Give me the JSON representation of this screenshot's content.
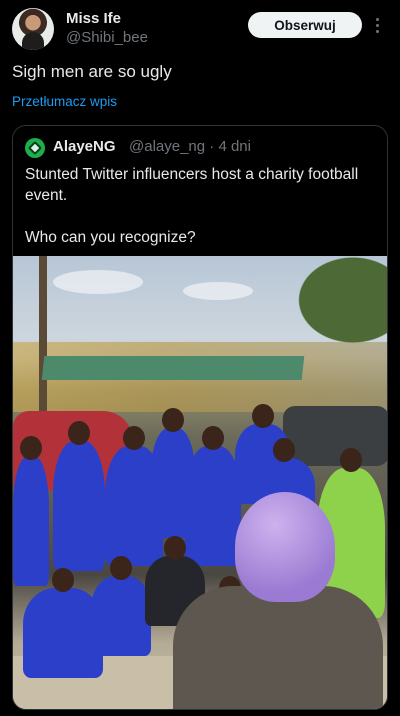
{
  "post": {
    "author_name": "Miss Ife",
    "author_handle": "@Shibi_bee",
    "follow_label": "Obserwuj",
    "text": "Sigh men are so ugly",
    "translate_label": "Przetłumacz wpis"
  },
  "quoted": {
    "author_name": "AlayeNG",
    "author_handle": "@alaye_ng",
    "separator": "·",
    "age": "4 dni",
    "meta": "@alaye_ng · 4 dni",
    "text": "Stunted Twitter influencers host a charity football event.\n\nWho can you recognize?"
  },
  "icons": {
    "more": "more-vertical-icon",
    "quoted_avatar": "alayeng-logo-icon"
  },
  "colors": {
    "background": "#000000",
    "link": "#1d9bf0",
    "secondary_text": "#71767b",
    "follow_button": "#eff3f4"
  }
}
